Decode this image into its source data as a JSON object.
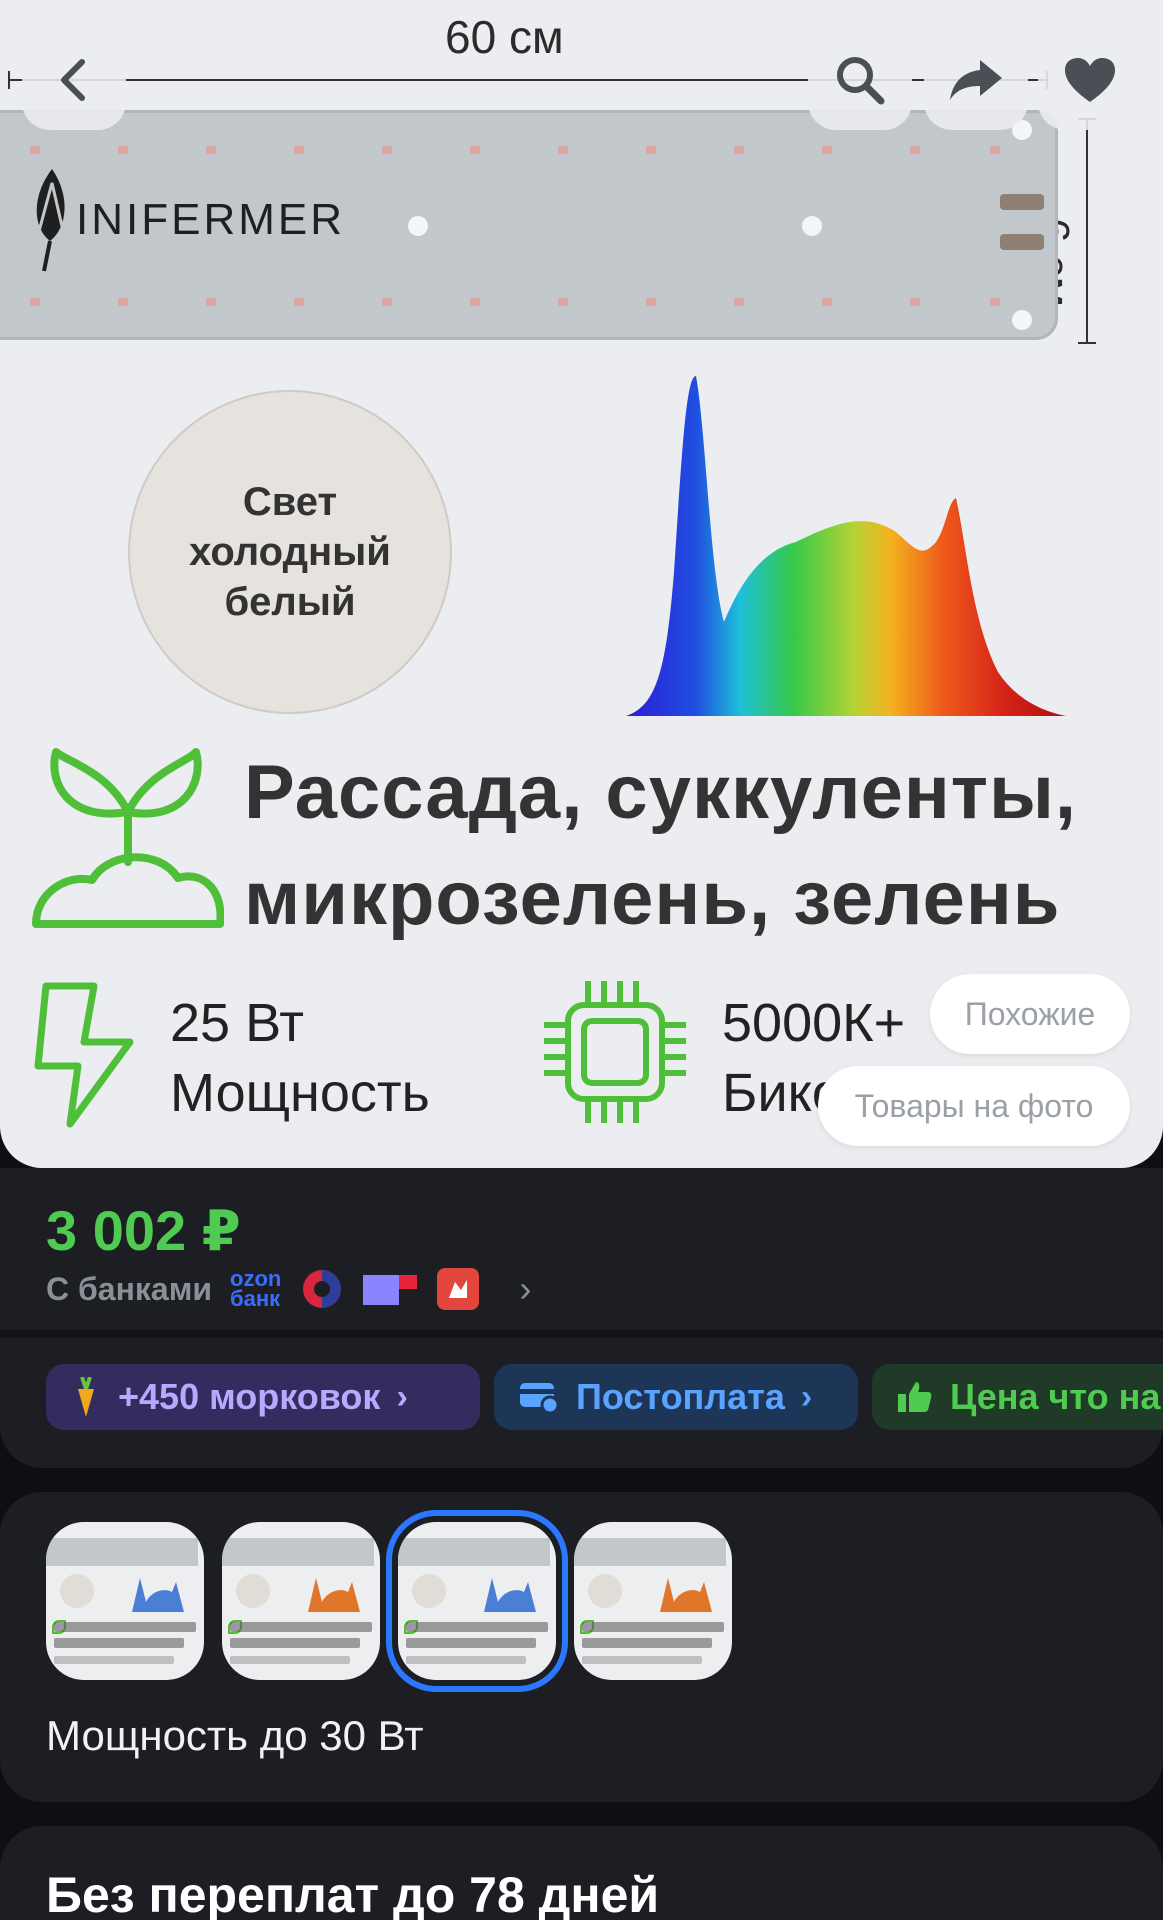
{
  "hero": {
    "width_label": "60 см",
    "height_label": "6 см",
    "brand": "INIFERMER",
    "circle_text": "Свет холодный белый",
    "feature_title_1": "Рассада, суккуленты,",
    "feature_title_2": "микрозелень, зелень",
    "power_value": "25 Вт",
    "power_label": "Мощность",
    "cct_value": "5000К+",
    "cct_label": "Бико",
    "similar_button": "Похожие",
    "on_photo_button": "Товары на фото",
    "icons": {
      "back": "chevron-left-icon",
      "search": "search-icon",
      "share": "share-icon",
      "favorite": "heart-icon"
    }
  },
  "price": {
    "amount": "3 002 ₽",
    "banks_label": "С банками",
    "ozon_line1": "ozon",
    "ozon_line2": "банк",
    "color": "#4fcb52"
  },
  "chips": [
    {
      "label": "+450 морковок",
      "icon": "carrot-icon"
    },
    {
      "label": "Постоплата",
      "icon": "card-icon"
    },
    {
      "label": "Цена что на",
      "icon": "thumbs-up-icon"
    }
  ],
  "variants": {
    "selected_index": 2,
    "label": "Мощность до 30 Вт",
    "accent": "#2a78ff"
  },
  "bnpl": {
    "title": "Без переплат до 78 дней"
  }
}
